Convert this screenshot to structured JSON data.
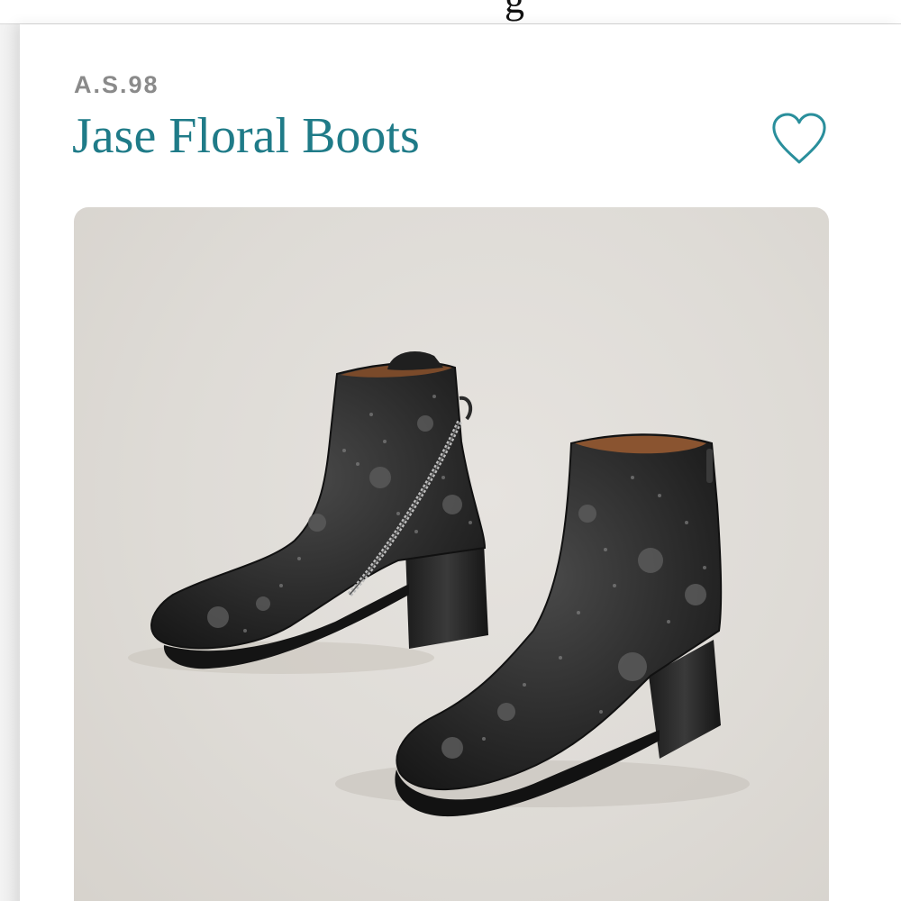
{
  "header": {
    "peek_text": "g"
  },
  "product": {
    "brand": "A.S.98",
    "title": "Jase Floral Boots",
    "wishlist_icon": "heart-outline-icon",
    "image_icon": "boots-photo"
  },
  "colors": {
    "brand_gray": "#8a8a8a",
    "title_teal": "#1f7b88",
    "heart_teal": "#2a8f9c",
    "image_bg": "#dedbd6"
  }
}
